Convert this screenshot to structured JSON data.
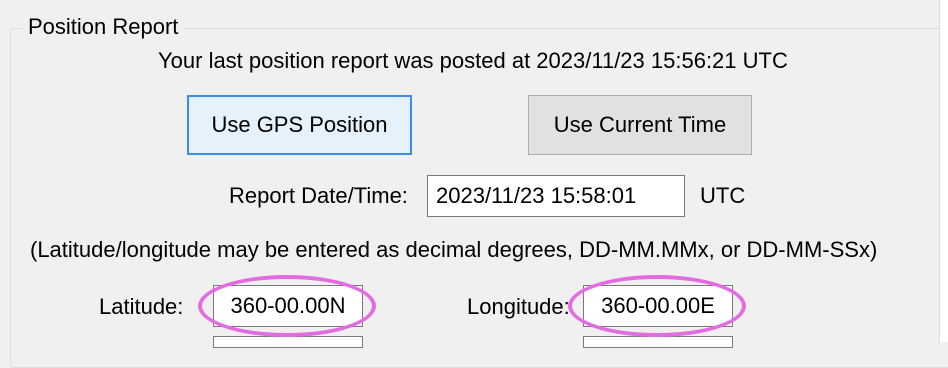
{
  "group": {
    "title": "Position Report"
  },
  "last_report": {
    "text": "Your last position report was posted at 2023/11/23 15:56:21 UTC"
  },
  "buttons": {
    "use_gps": "Use GPS Position",
    "use_time": "Use Current Time"
  },
  "report_datetime": {
    "label": "Report Date/Time:",
    "value": "2023/11/23 15:58:01",
    "unit": "UTC"
  },
  "hint": {
    "text": "(Latitude/longitude may be entered as decimal degrees, DD-MM.MMx, or DD-MM-SSx)"
  },
  "latitude": {
    "label": "Latitude:",
    "value": "360-00.00N"
  },
  "longitude": {
    "label": "Longitude:",
    "value": "360-00.00E"
  },
  "colors": {
    "highlight": "#e36de0",
    "default_button_border": "#3a8ee6",
    "window_background": "#f0f0f0"
  }
}
